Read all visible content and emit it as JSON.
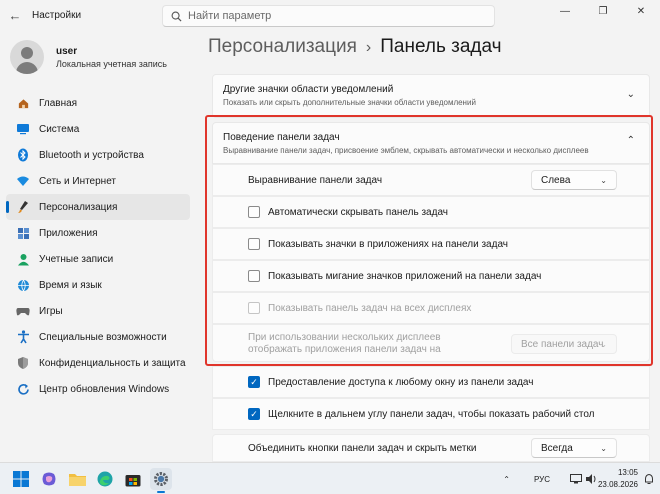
{
  "window": {
    "title": "Настройки",
    "search_placeholder": "Найти параметр"
  },
  "user": {
    "name": "user",
    "account_type": "Локальная учетная запись"
  },
  "sidebar": {
    "items": [
      {
        "label": "Главная",
        "icon": "home-icon"
      },
      {
        "label": "Система",
        "icon": "system-icon"
      },
      {
        "label": "Bluetooth и устройства",
        "icon": "bluetooth-icon"
      },
      {
        "label": "Сеть и Интернет",
        "icon": "wifi-icon"
      },
      {
        "label": "Персонализация",
        "icon": "brush-icon",
        "active": true
      },
      {
        "label": "Приложения",
        "icon": "apps-icon"
      },
      {
        "label": "Учетные записи",
        "icon": "person-icon"
      },
      {
        "label": "Время и язык",
        "icon": "globe-icon"
      },
      {
        "label": "Игры",
        "icon": "gamepad-icon"
      },
      {
        "label": "Специальные возможности",
        "icon": "accessibility-icon"
      },
      {
        "label": "Конфиденциальность и защита",
        "icon": "shield-icon"
      },
      {
        "label": "Центр обновления Windows",
        "icon": "update-icon"
      }
    ]
  },
  "breadcrumb": {
    "parent": "Персонализация",
    "separator": "›",
    "current": "Панель задач"
  },
  "sections": {
    "tray_icons": {
      "title": "Другие значки области уведомлений",
      "subtitle": "Показать или скрыть дополнительные значки области уведомлений"
    },
    "behavior": {
      "title": "Поведение панели задач",
      "subtitle": "Выравнивание панели задач, присвоение эмблем, скрывать автоматически и несколько дисплеев"
    }
  },
  "settings": {
    "alignment_label": "Выравнивание панели задач",
    "alignment_value": "Слева",
    "auto_hide": {
      "label": "Автоматически скрывать панель задач",
      "checked": false
    },
    "badges": {
      "label": "Показывать значки в приложениях на панели задач",
      "checked": false
    },
    "flashing": {
      "label": "Показывать мигание значков приложений на панели задач",
      "checked": false
    },
    "all_displays": {
      "label": "Показывать панель задач на всех дисплеях",
      "checked": false,
      "disabled": true
    },
    "multi_display_label": "При использовании нескольких дисплеев отображать приложения панели задач на",
    "multi_display_value": "Все панели задач",
    "share_window": {
      "label": "Предоставление доступа к любому окну из панели задач",
      "checked": true
    },
    "far_corner": {
      "label": "Щелкните в дальнем углу панели задач, чтобы показать рабочий стол",
      "checked": true
    },
    "combine_label": "Объединить кнопки панели задач и скрыть метки",
    "combine_value": "Всегда"
  },
  "taskbar": {
    "language": "РУС",
    "time": "13:05",
    "date": "23.08.2026"
  },
  "colors": {
    "accent": "#0067c0",
    "highlight": "#e0352b"
  }
}
